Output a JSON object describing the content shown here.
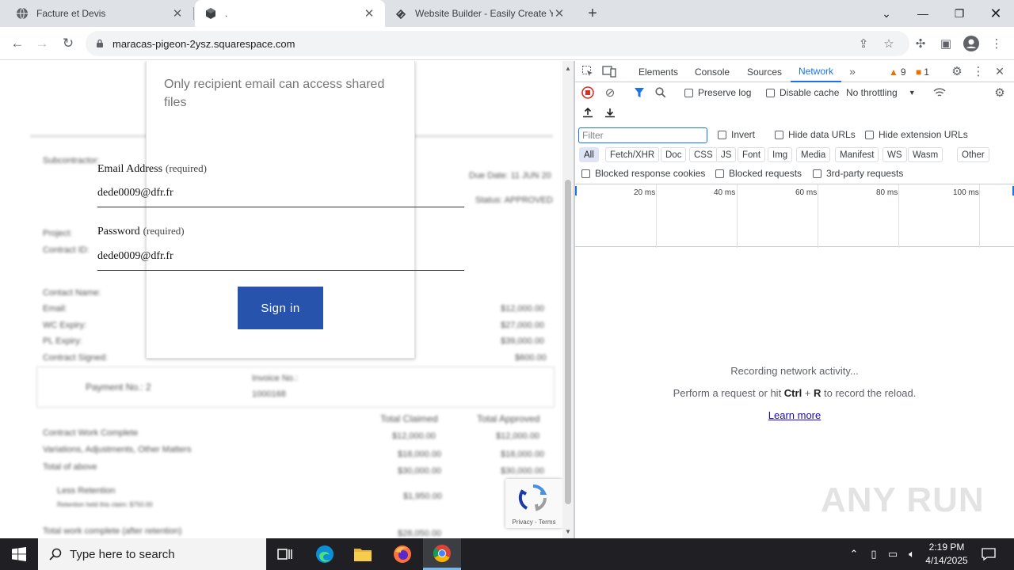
{
  "browser": {
    "tabs": [
      {
        "title": "Facture et Devis",
        "active": false
      },
      {
        "title": ".",
        "active": true
      },
      {
        "title": "Website Builder - Easily Create Yo",
        "active": false
      }
    ],
    "new_tab_label": "+",
    "url": "maracas-pigeon-2ysz.squarespace.com"
  },
  "page": {
    "info_text": "Only recipient email can access shared files",
    "email_label": "Email Address",
    "email_required": "(required)",
    "email_value": "dede0009@dfr.fr",
    "password_label": "Password",
    "password_required": "(required)",
    "password_value": "dede0009@dfr.fr",
    "signin_label": "Sign in",
    "recaptcha_links": "Privacy - Terms",
    "background_doc": {
      "subcontractor": "Subcontractor:",
      "due_date": "Due Date: 11 JUN 20",
      "status": "Status: APPROVED",
      "project": "Project:",
      "contract_id": "Contract ID:",
      "contact_name": "Contact Name:",
      "email": "Email:",
      "wc_expiry": "WC Expiry:",
      "pl_expiry": "PL Expiry:",
      "contract_signed": "Contract Signed:",
      "amounts_right": [
        "$12,000.00",
        "$27,000.00",
        "$39,000.00",
        "$600.00"
      ],
      "payment_no": "Payment No.: 2",
      "invoice_no": "Invoice No.:",
      "invoice_val": "1000168",
      "total_claimed": "Total Claimed",
      "total_approved": "Total Approved",
      "lines": [
        {
          "label": "Contract Work Complete",
          "claimed": "$12,000.00",
          "approved": "$12,000.00"
        },
        {
          "label": "Variations, Adjustments, Other Matters",
          "claimed": "$18,000.00",
          "approved": "$18,000.00"
        },
        {
          "label": "Total of above",
          "claimed": "$30,000.00",
          "approved": "$30,000.00"
        }
      ],
      "less_retention": "Less Retention",
      "retention_sub": "Retention held this claim: $750.00",
      "retention_val": "$1,950.00",
      "total_after": "Total work complete (after retention)",
      "total_after_val": "$28,050.00"
    }
  },
  "devtools": {
    "tabs": [
      "Elements",
      "Console",
      "Sources",
      "Network"
    ],
    "active_tab": "Network",
    "warnings": "9",
    "issues": "1",
    "preserve_log": "Preserve log",
    "disable_cache": "Disable cache",
    "throttling": "No throttling",
    "filter_placeholder": "Filter",
    "invert": "Invert",
    "hide_data_urls": "Hide data URLs",
    "hide_extension_urls": "Hide extension URLs",
    "type_filters": [
      "All",
      "Fetch/XHR",
      "Doc",
      "CSS",
      "JS",
      "Font",
      "Img",
      "Media",
      "Manifest",
      "WS",
      "Wasm",
      "Other"
    ],
    "blocked_cookies": "Blocked response cookies",
    "blocked_requests": "Blocked requests",
    "third_party": "3rd-party requests",
    "timeline_labels": [
      "20 ms",
      "40 ms",
      "60 ms",
      "80 ms",
      "100 ms"
    ],
    "empty_title": "Recording network activity...",
    "empty_pre": "Perform a request or hit ",
    "empty_key1": "Ctrl",
    "empty_plus": " + ",
    "empty_key2": "R",
    "empty_post": " to record the reload.",
    "learn_more": "Learn more"
  },
  "taskbar": {
    "search_placeholder": "Type here to search",
    "time": "2:19 PM",
    "date": "4/14/2025"
  },
  "watermark": "ANY RUN",
  "colors": {
    "signin_bg": "#2753ad",
    "devtools_accent": "#1a73e8",
    "record": "#d93025"
  }
}
